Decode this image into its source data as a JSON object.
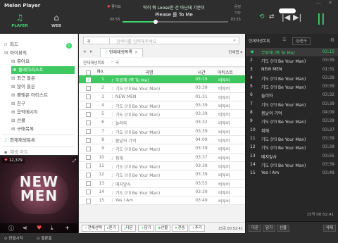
{
  "app": {
    "title": "Melon Player"
  },
  "nav": {
    "player": "PLAYER",
    "web": "WEB"
  },
  "now_playing": {
    "like_label": "좋아요",
    "artist_line": "딱히 뭐 Loose한 건 아닌데 기분이",
    "title_line": "Please 를 To Me",
    "quality": "음질",
    "quality_sub": "기타",
    "current_time": "00:55",
    "total_time": "03:15",
    "progress": 0.31
  },
  "controls": {
    "volume": 0.7
  },
  "sidebar": {
    "items": [
      {
        "label": "피드",
        "badge": "1"
      },
      {
        "label": "마이뮤직"
      },
      {
        "label": "뮤아요"
      },
      {
        "label": "플레이리스트"
      },
      {
        "label": "최근 들은"
      },
      {
        "label": "많이 들은"
      },
      {
        "label": "팬맺은 아티스트"
      },
      {
        "label": "친구"
      },
      {
        "label": "음악메시지"
      },
      {
        "label": "선물"
      },
      {
        "label": "구매목록"
      },
      {
        "label": "현재재생목록"
      },
      {
        "label": "재생 차트"
      }
    ]
  },
  "album": {
    "likes": "12,379",
    "text_line1": "NEW",
    "text_line2": "MEN"
  },
  "footer": {
    "connect": "연결시작",
    "home": "멜론홈"
  },
  "search": {
    "value": "곡",
    "placeholder": "검색어를 입력해주세요"
  },
  "tabs": {
    "current": "현재재생목록",
    "view_all": "전체탭"
  },
  "breadcrumb": {
    "path": "현재재생목록",
    "sep": "›",
    "current": "곡"
  },
  "table": {
    "headers": {
      "no": "No.",
      "title": "곡명",
      "time": "시간",
      "artist": "아티스트"
    },
    "rows": [
      {
        "no": "1",
        "title": "무료해 (쪽 To Me)",
        "time": "03:15",
        "artist": "비투비"
      },
      {
        "no": "2",
        "title": "기도 (I'll Be Your Man)",
        "time": "03:39",
        "artist": "비투비"
      },
      {
        "no": "3",
        "title": "NEW MEN",
        "time": "01:31",
        "artist": "비투비"
      },
      {
        "no": "4",
        "title": "기도 (I'll Be Your Man)",
        "time": "03:39",
        "artist": "비투비"
      },
      {
        "no": "5",
        "title": "기도 (I'll Be Your Man)",
        "time": "03:39",
        "artist": "비투비"
      },
      {
        "no": "6",
        "title": "놀러와",
        "time": "03:32",
        "artist": "비투비"
      },
      {
        "no": "7",
        "title": "기도 (I'll Be Your Man)",
        "time": "03:39",
        "artist": "비투비"
      },
      {
        "no": "8",
        "title": "봄날의 기억",
        "time": "04:09",
        "artist": "비투비"
      },
      {
        "no": "9",
        "title": "기도 (I'll Be Your Man)",
        "time": "03:39",
        "artist": "비투비"
      },
      {
        "no": "10",
        "title": "취해",
        "time": "03:37",
        "artist": "비투비"
      },
      {
        "no": "11",
        "title": "기도 (I'll Be Your Man)",
        "time": "03:39",
        "artist": "비투비"
      },
      {
        "no": "12",
        "title": "기도 (I'll Be Your Man)",
        "time": "03:39",
        "artist": "비투비"
      },
      {
        "no": "13",
        "title": "메지앞사",
        "time": "03:55",
        "artist": "비투비"
      },
      {
        "no": "14",
        "title": "기도 (I'll Be Your Man)",
        "time": "03:39",
        "artist": "비투비"
      },
      {
        "no": "15",
        "title": "Yes I Am",
        "time": "03:49",
        "artist": "비투비"
      }
    ]
  },
  "actions": {
    "select_all": "전체선택",
    "listen": "듣기",
    "download": "다운",
    "put": "담기",
    "gift": "선물",
    "share": "전송",
    "add": "추가",
    "count": "15곡 00:52:41"
  },
  "playlist": {
    "tab_now": "현재재생목록",
    "tab_friend": "친구",
    "rows": [
      {
        "no": "1",
        "title": "무료해 (쪽 To Me)",
        "time": "03:15"
      },
      {
        "no": "2",
        "title": "기도 (I'll Be Your Man)",
        "time": "03:39"
      },
      {
        "no": "3",
        "title": "NEW MEN",
        "time": "01:31"
      },
      {
        "no": "4",
        "title": "기도 (I'll Be Your Man)",
        "time": "03:39"
      },
      {
        "no": "5",
        "title": "기도 (I'll Be Your Man)",
        "time": "03:39"
      },
      {
        "no": "6",
        "title": "놀러와",
        "time": "03:32"
      },
      {
        "no": "7",
        "title": "기도 (I'll Be Your Man)",
        "time": "03:39"
      },
      {
        "no": "8",
        "title": "봄날의 기억",
        "time": "04:09"
      },
      {
        "no": "9",
        "title": "기도 (I'll Be Your Man)",
        "time": "03:39"
      },
      {
        "no": "10",
        "title": "취해",
        "time": "03:37"
      },
      {
        "no": "11",
        "title": "기도 (I'll Be Your Man)",
        "time": "03:39"
      },
      {
        "no": "12",
        "title": "기도 (I'll Be Your Man)",
        "time": "03:39"
      },
      {
        "no": "13",
        "title": "메지앞사",
        "time": "03:55"
      },
      {
        "no": "14",
        "title": "기도 (I'll Be Your Man)",
        "time": "03:39"
      },
      {
        "no": "15",
        "title": "Yes I Am",
        "time": "03:49"
      }
    ],
    "summary": "15곡  00:52:41",
    "btn_delete": "다운",
    "btn_put": "담기",
    "btn_gift": "선물",
    "btn_remove": "삭제"
  },
  "colors": {
    "accent": "#3dc860",
    "header_bg": "#2e2e2e",
    "playlist_bg": "#272727"
  }
}
